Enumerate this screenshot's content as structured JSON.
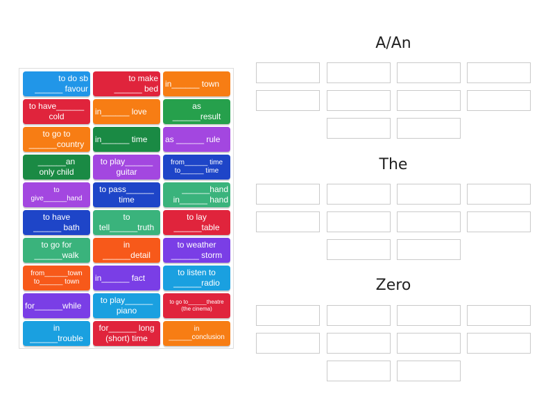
{
  "cards": [
    {
      "text": "to do sb\n______ favour",
      "color": "#2196e8"
    },
    {
      "text": "to make\n______ bed",
      "color": "#e0243c"
    },
    {
      "text": "in______ town",
      "color": "#f77d14"
    },
    {
      "text": "to have______\ncold",
      "color": "#e0243c"
    },
    {
      "text": "in______ love",
      "color": "#f77d14"
    },
    {
      "text": "as\n______result",
      "color": "#26a04c"
    },
    {
      "text": "to go to\n______country",
      "color": "#f77d14"
    },
    {
      "text": "in______ time",
      "color": "#1a8a44"
    },
    {
      "text": "as ______ rule",
      "color": "#a347e0"
    },
    {
      "text": "______an\nonly child",
      "color": "#1a8a44"
    },
    {
      "text": "to play______\nguitar",
      "color": "#a347e0"
    },
    {
      "text": "from______ time\nto______ time",
      "color": "#1e45c8"
    },
    {
      "text": "to\ngive______hand",
      "color": "#a347e0"
    },
    {
      "text": "to pass______\ntime",
      "color": "#1e45c8"
    },
    {
      "text": "______hand\nin______ hand",
      "color": "#3ab37c"
    },
    {
      "text": "to have\n______ bath",
      "color": "#1e45c8"
    },
    {
      "text": "to\ntell______truth",
      "color": "#3ab37c"
    },
    {
      "text": "to lay\n______table",
      "color": "#e0243c"
    },
    {
      "text": "to go for\n______walk",
      "color": "#3ab37c"
    },
    {
      "text": "in\n______detail",
      "color": "#f7591a"
    },
    {
      "text": "to weather\n______ storm",
      "color": "#7a3ee6"
    },
    {
      "text": "from______town\nto______ town",
      "color": "#f7591a"
    },
    {
      "text": "in______ fact",
      "color": "#7a3ee6"
    },
    {
      "text": "to listen to\n______radio",
      "color": "#1aa0e0"
    },
    {
      "text": "for______while",
      "color": "#7a3ee6"
    },
    {
      "text": "to play______\npiano",
      "color": "#1aa0e0"
    },
    {
      "text": "to go to______theatre\n(the cinema)",
      "color": "#e0243c"
    },
    {
      "text": "in\n______trouble",
      "color": "#1aa0e0"
    },
    {
      "text": "for______ long\n(short) time",
      "color": "#e0243c"
    },
    {
      "text": "in\n______conclusion",
      "color": "#f77d14"
    }
  ],
  "groups": [
    {
      "title": "A/An"
    },
    {
      "title": "The"
    },
    {
      "title": "Zero"
    }
  ]
}
